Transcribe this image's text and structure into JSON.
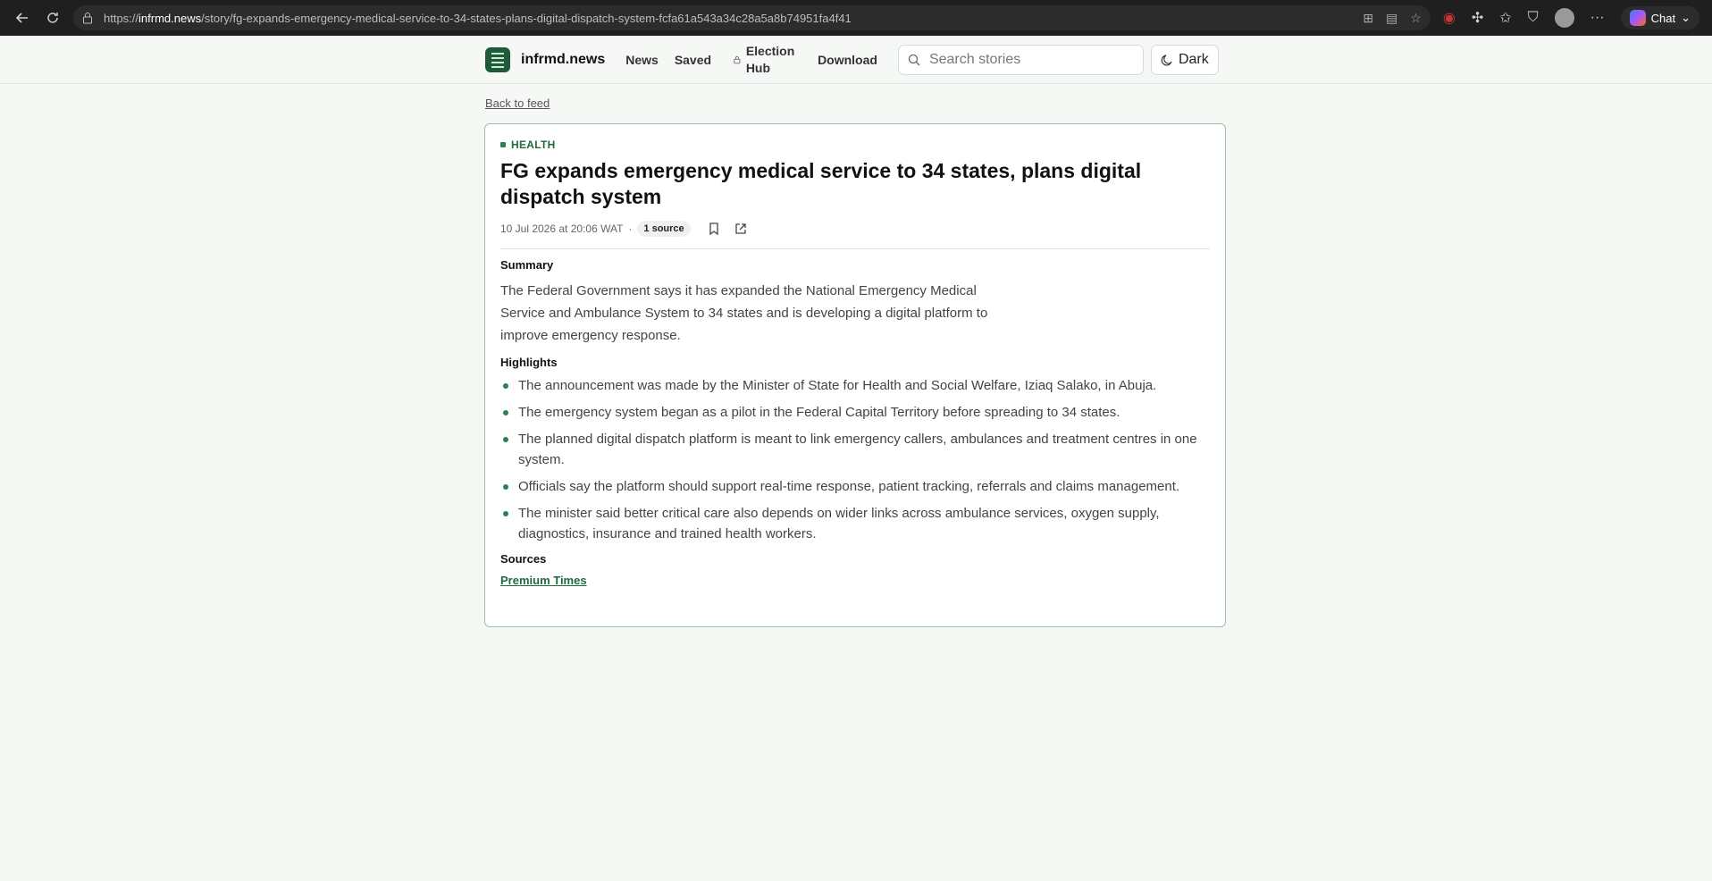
{
  "browser": {
    "url_prefix": "https://",
    "url_host": "infrmd.news",
    "url_path": "/story/fg-expands-emergency-medical-service-to-34-states-plans-digital-dispatch-system-fcfa61a543a34c28a5a8b74951fa4f41",
    "chat_label": "Chat"
  },
  "header": {
    "brand": "infrmd.news",
    "nav": [
      "News",
      "Saved"
    ],
    "election_hub": "Election Hub",
    "download": "Download",
    "search_placeholder": "Search stories",
    "theme_toggle": "Dark"
  },
  "article": {
    "back_link": "Back to feed",
    "category": "HEALTH",
    "title": "FG expands emergency medical service to 34 states, plans digital dispatch system",
    "date": "10 Jul 2026 at 20:06 WAT",
    "meta_sep": "·",
    "sources_count": "1 source",
    "summary_heading": "Summary",
    "summary": "The Federal Government says it has expanded the National Emergency Medical Service and Ambulance System to 34 states and is developing a digital platform to improve emergency response.",
    "highlights_heading": "Highlights",
    "highlights": [
      "The announcement was made by the Minister of State for Health and Social Welfare, Iziaq Salako, in Abuja.",
      "The emergency system began as a pilot in the Federal Capital Territory before spreading to 34 states.",
      "The planned digital dispatch platform is meant to link emergency callers, ambulances and treatment centres in one system.",
      "Officials say the platform should support real-time response, patient tracking, referrals and claims management.",
      "The minister said better critical care also depends on wider links across ambulance services, oxygen supply, diagnostics, insurance and trained health workers."
    ],
    "sources_heading": "Sources",
    "source_name": "Premium Times"
  }
}
